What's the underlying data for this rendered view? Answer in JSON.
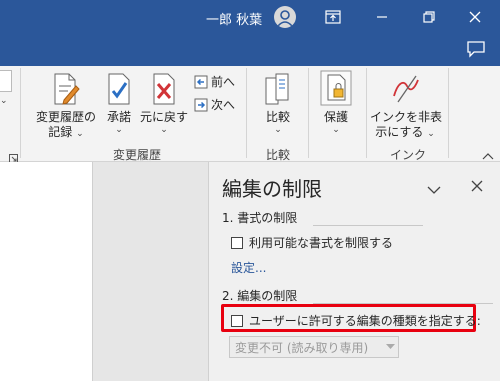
{
  "titlebar": {
    "user_name": "一郎 秋葉"
  },
  "ribbon": {
    "groups": {
      "track_changes": {
        "label": "変更履歴",
        "record_label_1": "変更履歴の",
        "record_label_2": "記録",
        "accept_label": "承諾",
        "reject_label": "元に戻す",
        "previous_label": "前へ",
        "next_label": "次へ"
      },
      "compare": {
        "label": "比較",
        "compare_label": "比較"
      },
      "protect": {
        "label": "",
        "protect_label": "保護"
      },
      "ink": {
        "label": "インク",
        "hide_ink_label_1": "インクを非表",
        "hide_ink_label_2": "示にする"
      }
    }
  },
  "pane": {
    "title": "編集の制限",
    "section1": {
      "heading": "1. 書式の制限",
      "checkbox_label": "利用可能な書式を制限する",
      "settings_link": "設定..."
    },
    "section2": {
      "heading": "2. 編集の制限",
      "checkbox_label": "ユーザーに許可する編集の種類を指定する:",
      "dropdown_value": "変更不可 (読み取り専用)"
    }
  },
  "colors": {
    "titlebar": "#2b579a",
    "highlight": "#e8000f",
    "link": "#2b579a"
  }
}
